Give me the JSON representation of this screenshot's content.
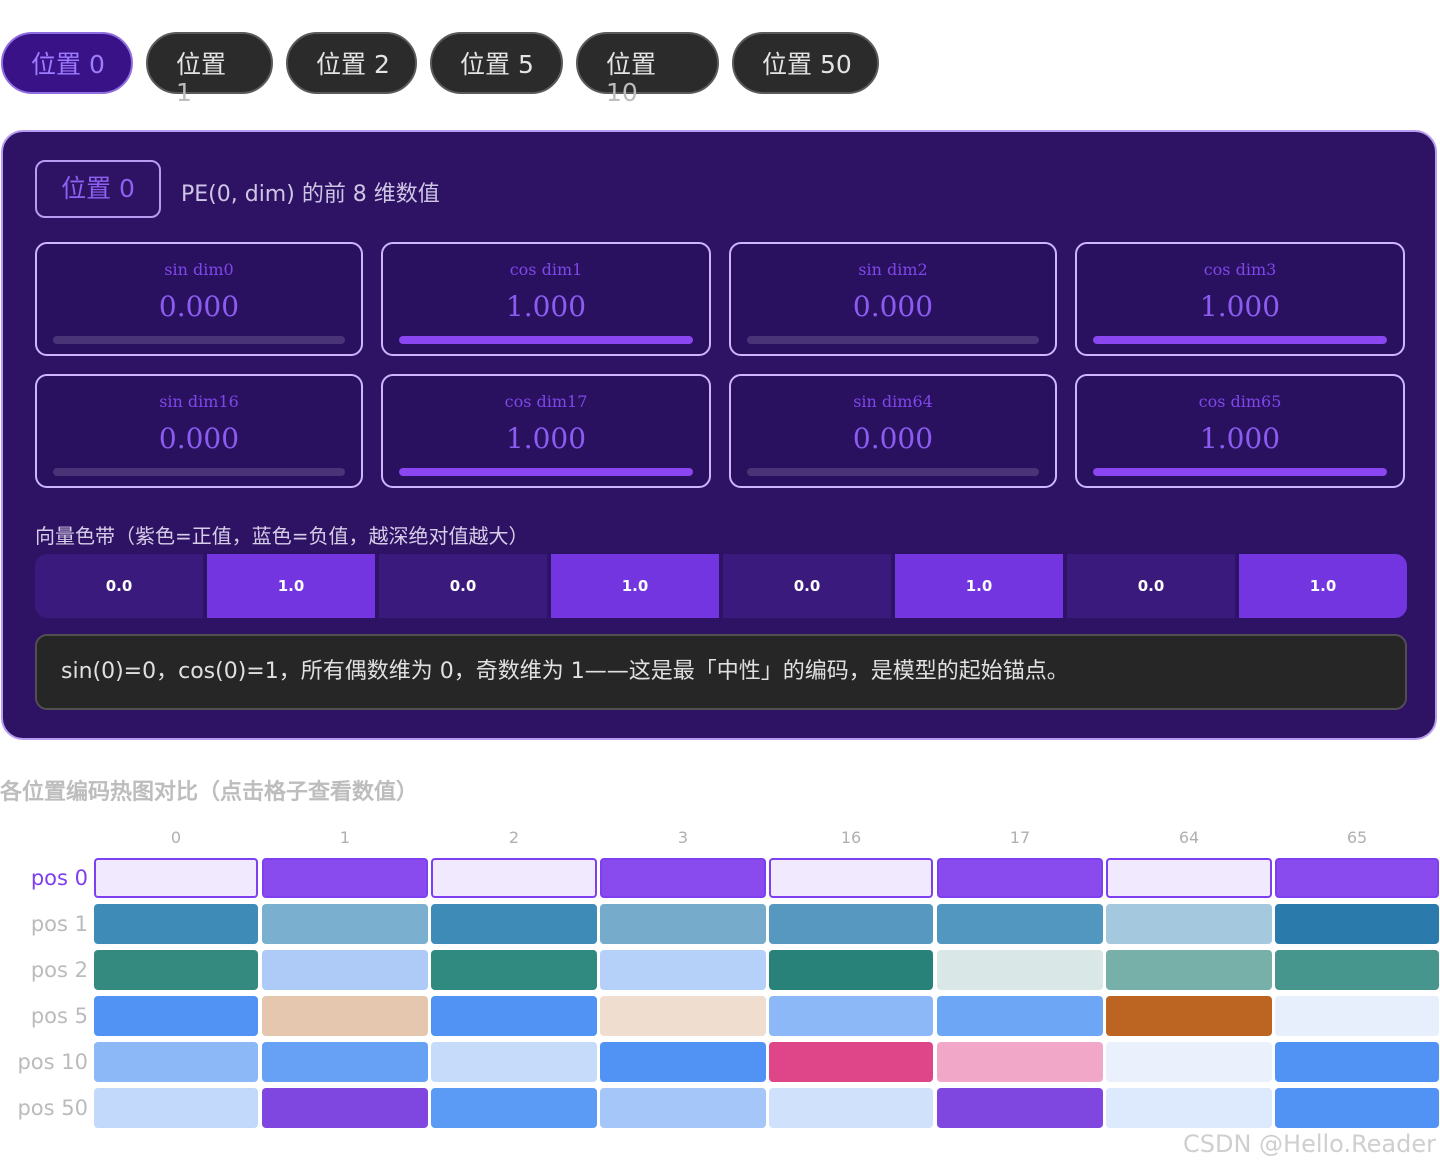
{
  "tabs": [
    {
      "label": "位置 0",
      "line1": "位置 0",
      "line2": "",
      "active": true
    },
    {
      "label": "位置 1",
      "line1": "位置",
      "line2": "1",
      "active": false
    },
    {
      "label": "位置 2",
      "line1": "位置 2",
      "line2": "",
      "active": false
    },
    {
      "label": "位置 5",
      "line1": "位置 5",
      "line2": "",
      "active": false
    },
    {
      "label": "位置 10",
      "line1": "位置",
      "line2": "10",
      "active": false
    },
    {
      "label": "位置 50",
      "line1": "位置 50",
      "line2": "",
      "active": false
    }
  ],
  "panel": {
    "badge": "位置 0",
    "title": "PE(0, dim) 的前 8 维数值",
    "cards": [
      {
        "label": "sin dim0",
        "value": "0.000",
        "fill": 0.0
      },
      {
        "label": "cos dim1",
        "value": "1.000",
        "fill": 1.0
      },
      {
        "label": "sin dim2",
        "value": "0.000",
        "fill": 0.0
      },
      {
        "label": "cos dim3",
        "value": "1.000",
        "fill": 1.0
      },
      {
        "label": "sin dim16",
        "value": "0.000",
        "fill": 0.0
      },
      {
        "label": "cos dim17",
        "value": "1.000",
        "fill": 1.0
      },
      {
        "label": "sin dim64",
        "value": "0.000",
        "fill": 0.0
      },
      {
        "label": "cos dim65",
        "value": "1.000",
        "fill": 1.0
      }
    ],
    "band_title": "向量色带（紫色=正值，蓝色=负值，越深绝对值越大）",
    "band": [
      {
        "label": "0.0",
        "color": "#3a1a7c"
      },
      {
        "label": "1.0",
        "color": "#7235e0"
      },
      {
        "label": "0.0",
        "color": "#3a1a7c"
      },
      {
        "label": "1.0",
        "color": "#7235e0"
      },
      {
        "label": "0.0",
        "color": "#3a1a7c"
      },
      {
        "label": "1.0",
        "color": "#7235e0"
      },
      {
        "label": "0.0",
        "color": "#3a1a7c"
      },
      {
        "label": "1.0",
        "color": "#7235e0"
      }
    ],
    "note": "sin(0)=0，cos(0)=1，所有偶数维为 0，奇数维为 1——这是最「中性」的编码，是模型的起始锚点。"
  },
  "heatmap": {
    "title": "各位置编码热图对比（点击格子查看数值）",
    "columns": [
      "0",
      "1",
      "2",
      "3",
      "16",
      "17",
      "64",
      "65"
    ],
    "rows": [
      {
        "label": "pos 0",
        "active": true,
        "colors": [
          "#f1e9fd",
          "#8a4bee",
          "#f1e9fd",
          "#8a4bee",
          "#f1e9fd",
          "#8a4bee",
          "#f1e9fd",
          "#8a4bee"
        ]
      },
      {
        "label": "pos 1",
        "active": false,
        "colors": [
          "#3d8bb6",
          "#7aafd0",
          "#3d8bb6",
          "#76abcc",
          "#5698c0",
          "#5297c0",
          "#a4c8de",
          "#2a7bab"
        ]
      },
      {
        "label": "pos 2",
        "active": false,
        "colors": [
          "#358a80",
          "#aecaf7",
          "#308a80",
          "#b5d1f9",
          "#288279",
          "#d9e8e6",
          "#76b0a8",
          "#47968d"
        ]
      },
      {
        "label": "pos 5",
        "active": false,
        "colors": [
          "#5193f5",
          "#e5c7b0",
          "#5093f5",
          "#efddd0",
          "#8db8f7",
          "#6ea6f6",
          "#bc6422",
          "#e7effd"
        ]
      },
      {
        "label": "pos 10",
        "active": false,
        "colors": [
          "#8db8f7",
          "#66a1f6",
          "#c6dbfa",
          "#5193f5",
          "#df468a",
          "#f1a8c8",
          "#eaf1fd",
          "#5193f5"
        ]
      },
      {
        "label": "pos 50",
        "active": false,
        "colors": [
          "#c2d9fb",
          "#8047e0",
          "#5b9bf5",
          "#a4c6f9",
          "#cfe1fb",
          "#8047e0",
          "#dde9fc",
          "#5193f5"
        ]
      }
    ]
  },
  "watermark": "CSDN @Hello.Reader"
}
